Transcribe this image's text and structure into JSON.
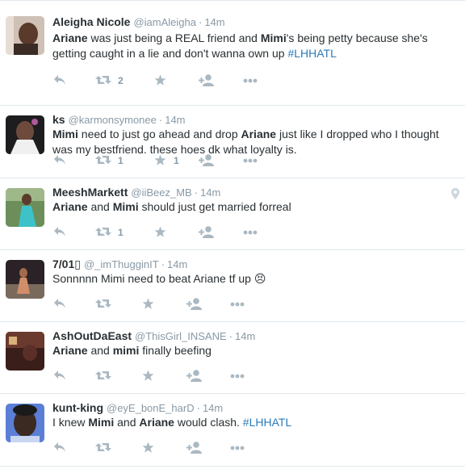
{
  "tweets": [
    {
      "name": "Aleigha Nicole",
      "handle": "@iamAleigha",
      "time": "14m",
      "text_parts": [
        {
          "b": true,
          "t": "Ariane"
        },
        {
          "t": " was just being a REAL friend and "
        },
        {
          "b": true,
          "t": "Mimi"
        },
        {
          "t": "'s being petty because she's getting caught in a lie and don't wanna own up "
        },
        {
          "h": true,
          "t": "#LHHATL"
        }
      ],
      "retweets": "2",
      "likes": ""
    },
    {
      "name": "ks",
      "handle": "@karmonsymonee",
      "time": "14m",
      "text_parts": [
        {
          "b": true,
          "t": "Mimi"
        },
        {
          "t": " need to just go ahead and drop "
        },
        {
          "b": true,
          "t": "Ariane"
        },
        {
          "t": " just like I dropped who I thought was my bestfriend. these hoes dk what loyalty is."
        }
      ],
      "retweets": "1",
      "likes": "1"
    },
    {
      "name": "MeeshMarkett",
      "handle": "@iiBeez_MB",
      "time": "14m",
      "text_parts": [
        {
          "b": true,
          "t": "Ariane"
        },
        {
          "t": " and "
        },
        {
          "b": true,
          "t": "Mimi"
        },
        {
          "t": " should just get married forreal"
        }
      ],
      "retweets": "1",
      "likes": "",
      "geo": "location-pin-icon"
    },
    {
      "name": "7/01▯",
      "handle": "@_imThugginIT",
      "time": "14m",
      "text_parts": [
        {
          "t": "Sonnnnn Mimi need to beat Ariane tf up 😣"
        }
      ],
      "retweets": "",
      "likes": ""
    },
    {
      "name": "AshOutDaEast",
      "handle": "@ThisGirl_INSANE",
      "time": "14m",
      "text_parts": [
        {
          "b": true,
          "t": "Ariane"
        },
        {
          "t": " and "
        },
        {
          "b": true,
          "t": "mimi"
        },
        {
          "t": " finally beefing"
        }
      ],
      "retweets": "",
      "likes": ""
    },
    {
      "name": "kunt-king",
      "handle": "@eyE_bonE_harD",
      "time": "14m",
      "text_parts": [
        {
          "t": "I knew "
        },
        {
          "b": true,
          "t": "Mimi"
        },
        {
          "t": " and "
        },
        {
          "b": true,
          "t": "Ariane"
        },
        {
          "t": " would clash. "
        },
        {
          "h": true,
          "t": "#LHHATL"
        }
      ],
      "retweets": "",
      "likes": ""
    }
  ],
  "colors": {
    "icon": "#aab8c2",
    "meta": "#8899a6",
    "hashtag": "#2b7bb9",
    "text": "#292f33"
  }
}
